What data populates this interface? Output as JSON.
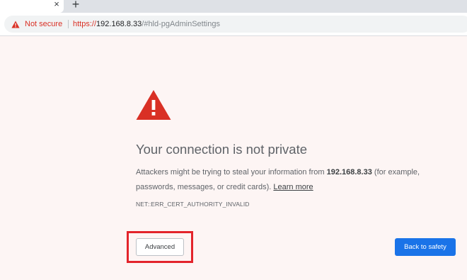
{
  "browser": {
    "tab": {
      "close_glyph": "×"
    },
    "new_tab_glyph": "+",
    "omnibox": {
      "security_label": "Not secure",
      "url_scheme": "https://",
      "url_host": "192.168.8.33",
      "url_path": "/#hld-pgAdminSettings",
      "security_color": "#d93025"
    }
  },
  "interstitial": {
    "icon": "warning-triangle-icon",
    "heading": "Your connection is not private",
    "explanation_pre": "Attackers might be trying to steal your information from ",
    "explanation_host": "192.168.8.33",
    "explanation_post": " (for example, passwords, messages, or credit cards). ",
    "learn_more": "Learn more",
    "error_code": "NET::ERR_CERT_AUTHORITY_INVALID",
    "advanced_label": "Advanced",
    "back_label": "Back to safety",
    "warning_color": "#d93025",
    "primary_color": "#1a73e8",
    "highlight_color": "#e3242b"
  }
}
